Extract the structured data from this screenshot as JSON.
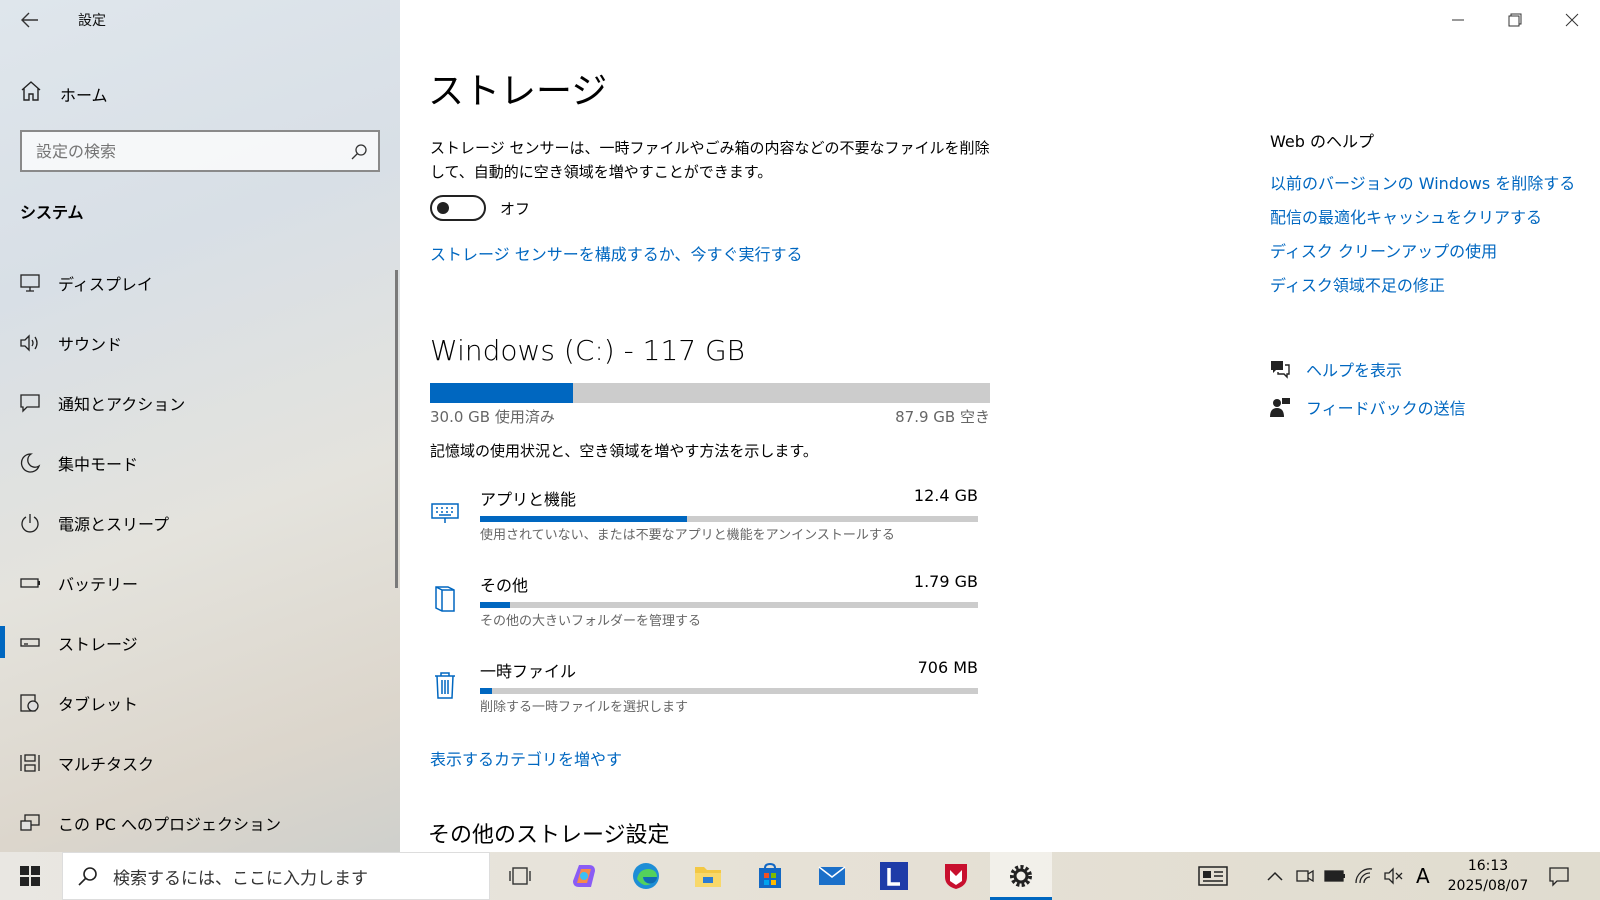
{
  "window": {
    "title": "設定"
  },
  "sidebar": {
    "home_label": "ホーム",
    "search_placeholder": "設定の検索",
    "section_title": "システム",
    "items": [
      {
        "label": "ディスプレイ",
        "icon": "display-icon"
      },
      {
        "label": "サウンド",
        "icon": "sound-icon"
      },
      {
        "label": "通知とアクション",
        "icon": "notification-icon"
      },
      {
        "label": "集中モード",
        "icon": "moon-icon"
      },
      {
        "label": "電源とスリープ",
        "icon": "power-icon"
      },
      {
        "label": "バッテリー",
        "icon": "battery-icon"
      },
      {
        "label": "ストレージ",
        "icon": "storage-icon",
        "active": true
      },
      {
        "label": "タブレット",
        "icon": "tablet-icon"
      },
      {
        "label": "マルチタスク",
        "icon": "multitask-icon"
      },
      {
        "label": "この PC へのプロジェクション",
        "icon": "projection-icon"
      }
    ]
  },
  "main": {
    "title": "ストレージ",
    "description": "ストレージ センサーは、一時ファイルやごみ箱の内容などの不要なファイルを削除して、自動的に空き領域を増やすことができます。",
    "toggle_state": "オフ",
    "configure_link": "ストレージ センサーを構成するか、今すぐ実行する",
    "drive": {
      "title": "Windows (C:) - 117 GB",
      "used_label": "30.0 GB 使用済み",
      "free_label": "87.9 GB 空き",
      "used_fraction": 0.256
    },
    "usage_description": "記憶域の使用状況と、空き領域を増やす方法を示します。",
    "categories": [
      {
        "name": "アプリと機能",
        "size": "12.4 GB",
        "hint": "使用されていない、または不要なアプリと機能をアンインストールする",
        "fraction": 0.415,
        "icon": "keyboard-icon"
      },
      {
        "name": "その他",
        "size": "1.79 GB",
        "hint": "その他の大きいフォルダーを管理する",
        "fraction": 0.06,
        "icon": "folder-book-icon"
      },
      {
        "name": "一時ファイル",
        "size": "706 MB",
        "hint": "削除する一時ファイルを選択します",
        "fraction": 0.024,
        "icon": "trash-icon"
      }
    ],
    "more_categories_link": "表示するカテゴリを増やす",
    "other_settings_title": "その他のストレージ設定"
  },
  "help": {
    "title": "Web のヘルプ",
    "links": [
      "以前のバージョンの Windows を削除する",
      "配信の最適化キャッシュをクリアする",
      "ディスク クリーンアップの使用",
      "ディスク領域不足の修正"
    ],
    "get_help": "ヘルプを表示",
    "feedback": "フィードバックの送信"
  },
  "taskbar": {
    "search_placeholder": "検索するには、ここに入力します",
    "time": "16:13",
    "date": "2025/08/07",
    "ime": "A",
    "accent": "#0067c0"
  }
}
